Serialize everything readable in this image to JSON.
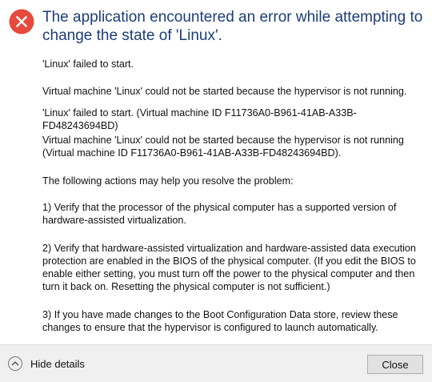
{
  "dialog": {
    "icon": "error-icon",
    "title": "The application encountered an error while attempting to change the state of 'Linux'.",
    "paragraphs": [
      "'Linux' failed to start.",
      "Virtual machine 'Linux' could not be started because the hypervisor is not running.",
      "'Linux' failed to start. (Virtual machine ID F11736A0-B961-41AB-A33B-FD48243694BD)",
      "Virtual machine 'Linux' could not be started because the hypervisor is not running (Virtual machine ID F11736A0-B961-41AB-A33B-FD48243694BD).",
      "The following actions may help you resolve the problem:",
      "1) Verify that the processor of the physical computer has a supported version of hardware-assisted virtualization.",
      "2) Verify that hardware-assisted virtualization and hardware-assisted data execution protection are enabled in the BIOS of the physical computer.  (If you edit the BIOS to enable either setting, you must turn off the power to the physical computer and then turn it back on.  Resetting the physical computer is not sufficient.)",
      "3) If you have made changes to the Boot Configuration Data store, review these changes to ensure that the hypervisor is configured to launch automatically."
    ]
  },
  "footer": {
    "details_toggle_label": "Hide details",
    "details_toggle_icon": "chevron-up-icon",
    "close_label": "Close"
  },
  "colors": {
    "title": "#1c3d7a",
    "error_red": "#e74a3c",
    "footer_bg": "#f0f0f0",
    "button_bg": "#e1e1e1"
  }
}
